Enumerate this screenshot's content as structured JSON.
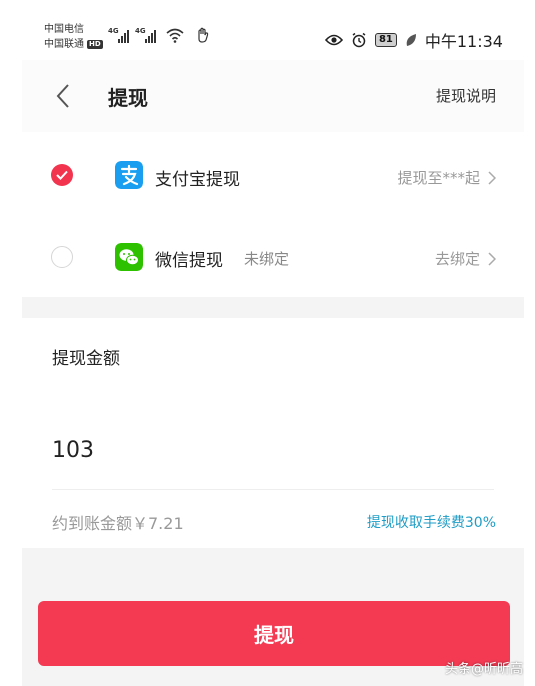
{
  "status_bar": {
    "carrier_1": "中国电信",
    "carrier_2": "中国联通",
    "hd_badge": "HD",
    "network_1": "4G",
    "network_2": "4G",
    "battery": "81",
    "time": "中午11:34"
  },
  "nav": {
    "title": "提现",
    "help_link": "提现说明"
  },
  "methods": [
    {
      "label": "支付宝提现",
      "sub": "",
      "right": "提现至***起",
      "selected": true
    },
    {
      "label": "微信提现",
      "sub": "未绑定",
      "right": "去绑定",
      "selected": false
    }
  ],
  "amount": {
    "label": "提现金额",
    "value": "103",
    "arrival_text": "约到账金额￥7.21",
    "fee_text": "提现收取手续费30%"
  },
  "submit_label": "提现",
  "watermark": "头条@昕昕高",
  "colors": {
    "accent": "#f33a52",
    "alipay": "#1a9ff0",
    "wechat": "#2dc100",
    "fee_link": "#1f9dc6"
  }
}
